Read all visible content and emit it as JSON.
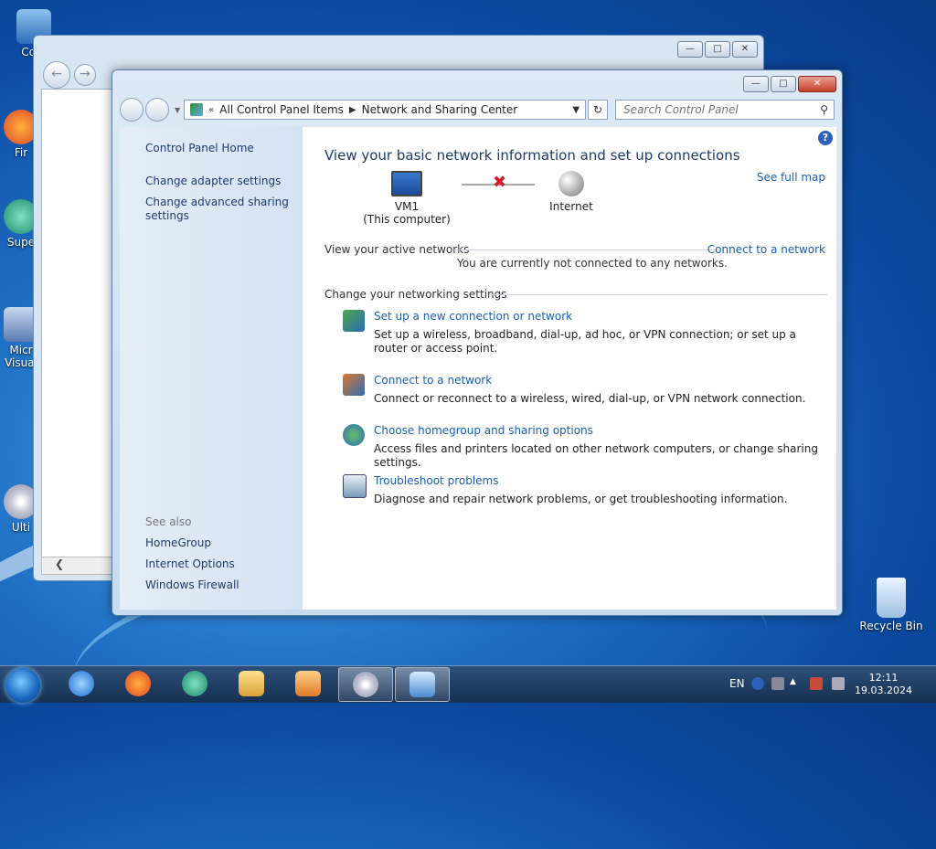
{
  "desktop": {
    "icons": [
      {
        "label": "Com"
      },
      {
        "label": "Fir"
      },
      {
        "label": "Supe"
      },
      {
        "label": "Micr"
      },
      {
        "label": "Visual"
      },
      {
        "label": "Ulti"
      },
      {
        "label": "Recycle Bin"
      }
    ]
  },
  "window": {
    "breadcrumb": {
      "root_label": "All Control Panel Items",
      "current_label": "Network and Sharing Center"
    },
    "search_placeholder": "Search Control Panel"
  },
  "sidebar": {
    "home_label": "Control Panel Home",
    "links": [
      "Change adapter settings",
      "Change advanced sharing",
      "settings"
    ],
    "see_also_label": "See also",
    "see_also": [
      "HomeGroup",
      "Internet Options",
      "Windows Firewall"
    ]
  },
  "main": {
    "title": "View your basic network information and set up connections",
    "see_full_map": "See full map",
    "computer_name": "VM1",
    "computer_sub": "(This computer)",
    "internet_label": "Internet",
    "active_networks_label": "View your active networks",
    "connect_link": "Connect to a network",
    "not_connected": "You are currently not connected to any networks.",
    "change_settings_label": "Change your networking settings",
    "tasks": [
      {
        "title": "Set up a new connection or network",
        "desc": "Set up a wireless, broadband, dial-up, ad hoc, or VPN connection; or set up a router or access point."
      },
      {
        "title": "Connect to a network",
        "desc": "Connect or reconnect to a wireless, wired, dial-up, or VPN network connection."
      },
      {
        "title": "Choose homegroup and sharing options",
        "desc": "Access files and printers located on other network computers, or change sharing settings."
      },
      {
        "title": "Troubleshoot problems",
        "desc": "Diagnose and repair network problems, or get troubleshooting information."
      }
    ]
  },
  "taskbar": {
    "language": "EN",
    "time": "12:11",
    "date": "19.03.2024"
  },
  "colors": {
    "link": "#1a5fb4",
    "heading": "#1e3a6a",
    "error_x": "#d0202a"
  }
}
